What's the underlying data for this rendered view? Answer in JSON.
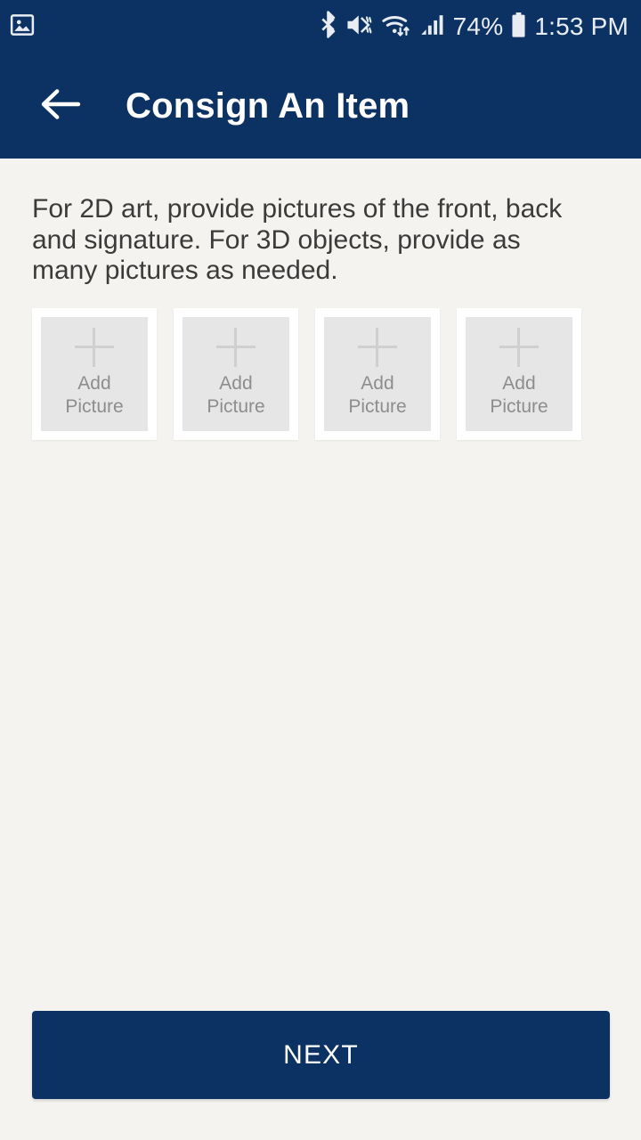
{
  "theme": {
    "primary": "#0c3264",
    "background": "#f5f3ef",
    "card_frame": "#ffffff",
    "card_inner": "#e6e6e6",
    "placeholder_text": "#8d8d8d",
    "body_text": "#3b3b3b"
  },
  "status_bar": {
    "notification_icon": "image-icon",
    "bluetooth_icon": "bluetooth-icon",
    "mute_vibrate_icon": "mute-vibrate-icon",
    "wifi_icon": "wifi-transfer-icon",
    "signal_icon": "cellular-signal-icon",
    "battery_percent": "74%",
    "battery_icon": "battery-icon",
    "time": "1:53 PM"
  },
  "app_bar": {
    "back_icon": "arrow-left-icon",
    "title": "Consign An Item"
  },
  "main": {
    "instructions": "For 2D art, provide pictures of the front, back and signature. For 3D objects, provide as many pictures as needed.",
    "picture_slots": [
      {
        "label": "Add\nPicture",
        "icon": "plus-icon"
      },
      {
        "label": "Add\nPicture",
        "icon": "plus-icon"
      },
      {
        "label": "Add\nPicture",
        "icon": "plus-icon"
      },
      {
        "label": "Add\nPicture",
        "icon": "plus-icon"
      }
    ]
  },
  "footer": {
    "next_label": "NEXT"
  }
}
